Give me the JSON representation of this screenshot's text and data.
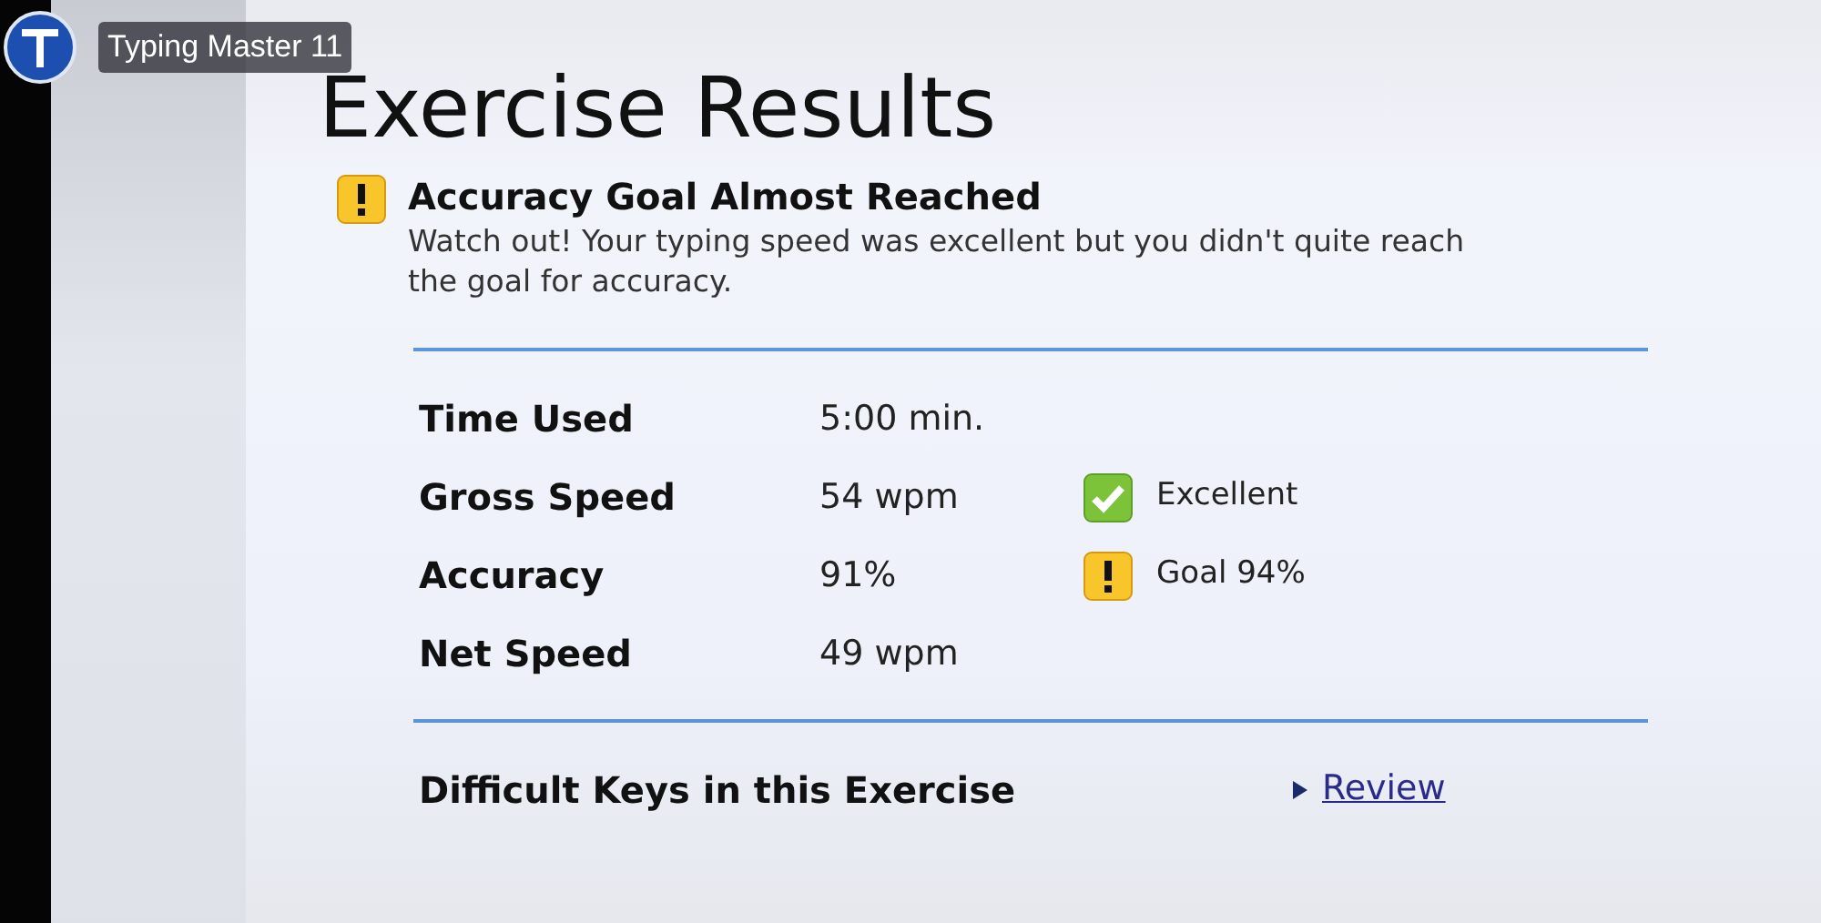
{
  "video_overlay": {
    "channel_title": "Typing Master 11"
  },
  "page_title": "Exercise Results",
  "alert": {
    "kind": "warning",
    "title": "Accuracy Goal Almost Reached",
    "message": "Watch out! Your typing speed was excellent but you didn't quite reach the goal for accuracy."
  },
  "stats": [
    {
      "label": "Time Used",
      "value": "5:00 min."
    },
    {
      "label": "Gross Speed",
      "value": "54 wpm",
      "status": {
        "kind": "ok",
        "text": "Excellent"
      }
    },
    {
      "label": "Accuracy",
      "value": "91%",
      "status": {
        "kind": "warning",
        "text": "Goal 94%"
      }
    },
    {
      "label": "Net Speed",
      "value": "49 wpm"
    }
  ],
  "footer": {
    "label": "Difficult Keys in this Exercise",
    "link": "Review"
  }
}
